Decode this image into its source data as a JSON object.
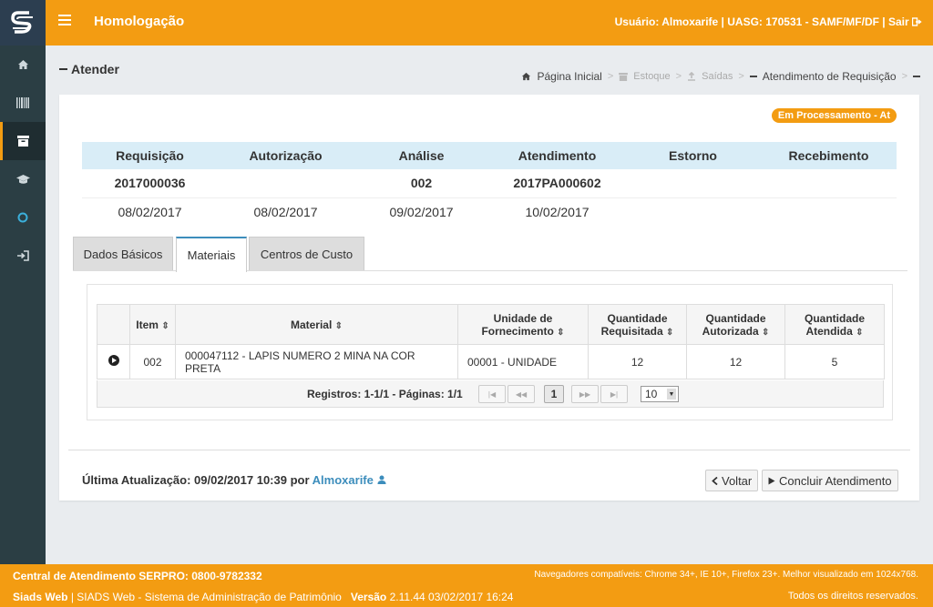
{
  "header": {
    "title": "Homologação",
    "user_info": "Usuário: Almoxarife | UASG: 170531 - SAMF/MF/DF | Sair"
  },
  "sidebar": {
    "items": [
      {
        "icon": "home-icon"
      },
      {
        "icon": "barcode-icon"
      },
      {
        "icon": "archive-icon"
      },
      {
        "icon": "graduation-cap-icon"
      },
      {
        "icon": "circle-icon"
      },
      {
        "icon": "sign-in-icon"
      }
    ]
  },
  "page": {
    "title": "Atender",
    "breadcrumb": {
      "home": "Página Inicial",
      "stock": "Estoque",
      "outputs": "Saídas",
      "current": "Atendimento de Requisição"
    },
    "status_badge": "Em Processamento - At"
  },
  "steps": {
    "headers": [
      "Requisição",
      "Autorização",
      "Análise",
      "Atendimento",
      "Estorno",
      "Recebimento"
    ],
    "codes": [
      "2017000036",
      "",
      "002",
      "2017PA000602",
      "",
      ""
    ],
    "dates": [
      "08/02/2017",
      "08/02/2017",
      "09/02/2017",
      "10/02/2017",
      "",
      ""
    ]
  },
  "tabs": [
    {
      "label": "Dados Básicos"
    },
    {
      "label": "Materiais"
    },
    {
      "label": "Centros de Custo"
    }
  ],
  "grid": {
    "columns": {
      "item": "Item",
      "material": "Material",
      "unit_line1": "Unidade de",
      "unit_line2": "Fornecimento",
      "req_line1": "Quantidade",
      "req_line2": "Requisitada",
      "auth_line1": "Quantidade",
      "auth_line2": "Autorizada",
      "att_line1": "Quantidade",
      "att_line2": "Atendida"
    },
    "rows": [
      {
        "item": "002",
        "material": "000047112 - LAPIS NUMERO 2 MINA NA COR PRETA",
        "unit": "00001 - UNIDADE",
        "requested": "12",
        "authorized": "12",
        "attended": "5"
      }
    ],
    "pager": {
      "info": "Registros: 1-1/1 - Páginas: 1/1",
      "current_page": "1",
      "page_size": "10"
    }
  },
  "footer_actions": {
    "last_update_label": "Última Atualização: 09/02/2017 10:39 por",
    "last_update_user": "Almoxarife",
    "back_label": "Voltar",
    "finish_label": "Concluir Atendimento"
  },
  "footer": {
    "support": "Central de Atendimento SERPRO: 0800-9782332",
    "browsers": "Navegadores compatíveis: Chrome 34+, IE 10+, Firefox 23+. Melhor visualizado em 1024x768.",
    "app_name": "Siads Web",
    "app_desc": "| SIADS Web - Sistema de Administração de Patrimônio",
    "version_label": "Versão",
    "version_value": "2.11.44 03/02/2017 16:24",
    "rights": "Todos os direitos reservados."
  },
  "colors": {
    "brand": "#f39c12",
    "sidebar": "#2b3e44",
    "link": "#3c8dbc"
  }
}
